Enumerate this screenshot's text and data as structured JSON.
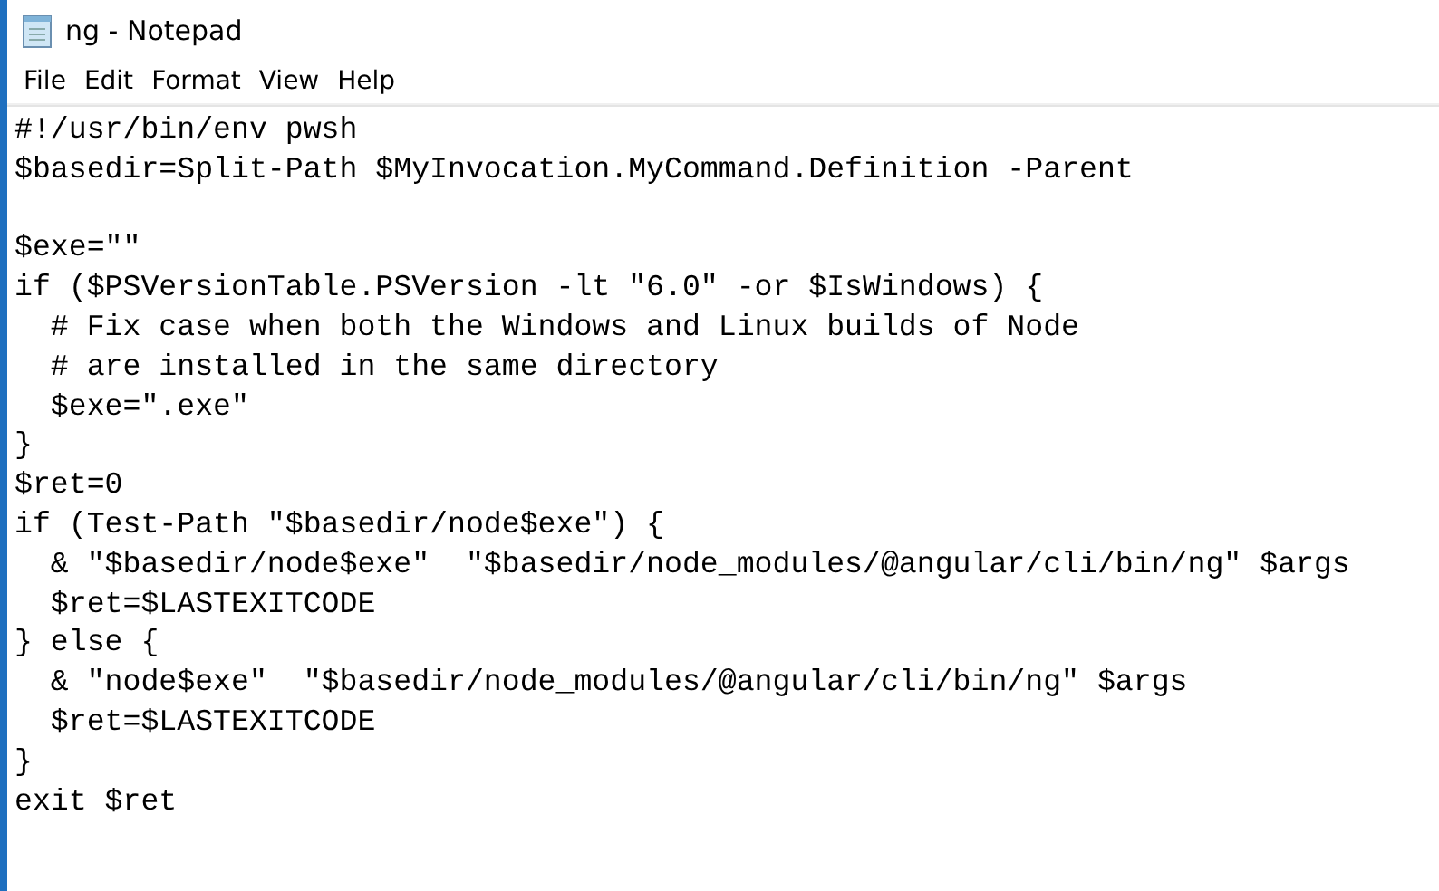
{
  "window": {
    "title": "ng - Notepad"
  },
  "menu": [
    "File",
    "Edit",
    "Format",
    "View",
    "Help"
  ],
  "editor": {
    "lines": [
      {
        "kind": "text",
        "text": "#!/usr/bin/env pwsh"
      },
      {
        "kind": "text",
        "text": "$basedir=Split-Path $MyInvocation.MyCommand.Definition -Parent"
      },
      {
        "kind": "blank"
      },
      {
        "kind": "text",
        "text": "$exe=\"\""
      },
      {
        "kind": "text",
        "text": "if ($PSVersionTable.PSVersion -lt \"6.0\" -or $IsWindows) {"
      },
      {
        "kind": "text",
        "text": "  # Fix case when both the Windows and Linux builds of Node"
      },
      {
        "kind": "text",
        "text": "  # are installed in the same directory"
      },
      {
        "kind": "text",
        "text": "  $exe=\".exe\""
      },
      {
        "kind": "text",
        "text": "}"
      },
      {
        "kind": "text",
        "text": "$ret=0"
      },
      {
        "kind": "text",
        "text": "if (Test-Path \"$basedir/node$exe\") {"
      },
      {
        "kind": "text",
        "text": "  & \"$basedir/node$exe\"  \"$basedir/node_modules/@angular/cli/bin/ng\" $args"
      },
      {
        "kind": "text",
        "text": "  $ret=$LASTEXITCODE"
      },
      {
        "kind": "text",
        "text": "} else {"
      },
      {
        "kind": "text",
        "text": "  & \"node$exe\"  \"$basedir/node_modules/@angular/cli/bin/ng\" $args"
      },
      {
        "kind": "text",
        "text": "  $ret=$LASTEXITCODE"
      },
      {
        "kind": "text",
        "text": "}"
      },
      {
        "kind": "text",
        "text": "exit $ret"
      }
    ]
  }
}
